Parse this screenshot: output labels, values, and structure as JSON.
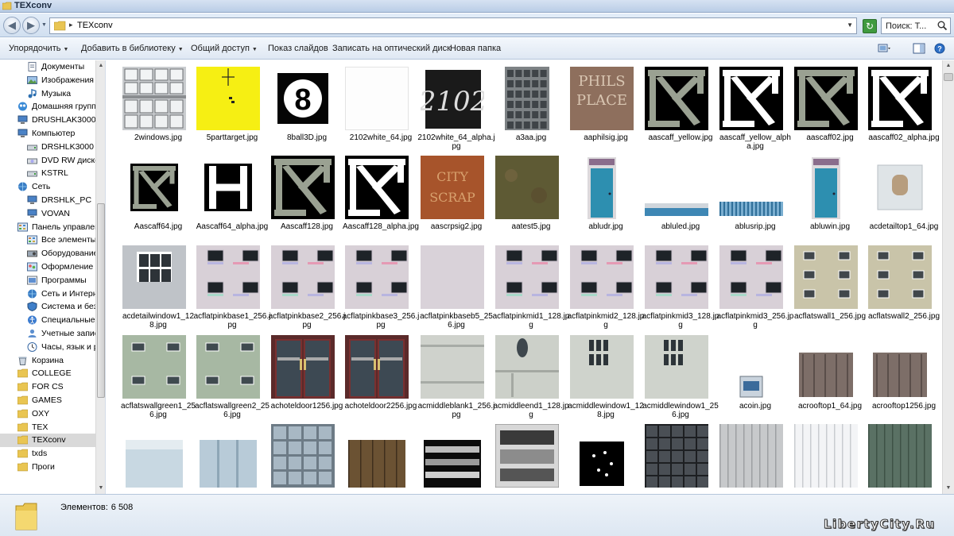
{
  "window": {
    "title": "TEXconv"
  },
  "address": {
    "path": "TEXconv",
    "search_placeholder": "Поиск: T..."
  },
  "toolbar": {
    "organize": "Упорядочить",
    "add_to_library": "Добавить в библиотеку",
    "share": "Общий доступ",
    "slideshow": "Показ слайдов",
    "burn": "Записать на оптический диск",
    "new_folder": "Новая папка"
  },
  "nav": {
    "items": [
      {
        "label": "Документы",
        "icon": "documents-icon"
      },
      {
        "label": "Изображения",
        "icon": "pictures-icon"
      },
      {
        "label": "Музыка",
        "icon": "music-icon"
      },
      {
        "label": "Домашняя группа",
        "icon": "homegroup-icon"
      },
      {
        "label": "DRUSHLAK3000",
        "icon": "computer-icon"
      },
      {
        "label": "Компьютер",
        "icon": "computer-icon"
      },
      {
        "label": "DRSHLK3000",
        "icon": "drive-icon"
      },
      {
        "label": "DVD RW дисковод",
        "icon": "dvd-icon"
      },
      {
        "label": "KSTRL",
        "icon": "drive-icon"
      },
      {
        "label": "Сеть",
        "icon": "network-icon"
      },
      {
        "label": "DRSHLK_PC",
        "icon": "computer-icon"
      },
      {
        "label": "VOVAN",
        "icon": "computer-icon"
      },
      {
        "label": "Панель управления",
        "icon": "control-panel-icon"
      },
      {
        "label": "Все элементы панели",
        "icon": "control-panel-icon"
      },
      {
        "label": "Оборудование и звук",
        "icon": "hardware-icon"
      },
      {
        "label": "Оформление и персонализация",
        "icon": "appearance-icon"
      },
      {
        "label": "Программы",
        "icon": "programs-icon"
      },
      {
        "label": "Сеть и Интернет",
        "icon": "network-icon"
      },
      {
        "label": "Система и безопасность",
        "icon": "security-icon"
      },
      {
        "label": "Специальные возможности",
        "icon": "accessibility-icon"
      },
      {
        "label": "Учетные записи",
        "icon": "users-icon"
      },
      {
        "label": "Часы, язык и регион",
        "icon": "clock-icon"
      },
      {
        "label": "Корзина",
        "icon": "recycle-bin-icon"
      },
      {
        "label": "COLLEGE",
        "icon": "folder-icon"
      },
      {
        "label": "FOR CS",
        "icon": "folder-icon"
      },
      {
        "label": "GAMES",
        "icon": "folder-icon"
      },
      {
        "label": "OXY",
        "icon": "folder-icon"
      },
      {
        "label": "TEX",
        "icon": "folder-icon"
      },
      {
        "label": "TEXconv",
        "icon": "folder-icon",
        "selected": true
      },
      {
        "label": "txds",
        "icon": "folder-icon"
      },
      {
        "label": "Проги",
        "icon": "folder-icon"
      }
    ]
  },
  "files": [
    {
      "name": "2windows.jpg",
      "kind": "windows-grid"
    },
    {
      "name": "5parttarget.jpg",
      "kind": "yellow-target"
    },
    {
      "name": "8ball3D.jpg",
      "kind": "eight-ball"
    },
    {
      "name": "2102white_64.jpg",
      "kind": "white"
    },
    {
      "name": "2102white_64_alpha.jpg",
      "kind": "text-2102"
    },
    {
      "name": "a3aa.jpg",
      "kind": "grey-building"
    },
    {
      "name": "aaphilsig.jpg",
      "kind": "phils-sign"
    },
    {
      "name": "aascaff_yellow.jpg",
      "kind": "scaffold"
    },
    {
      "name": "aascaff_yellow_alpha.jpg",
      "kind": "scaffold-alpha"
    },
    {
      "name": "aascaff02.jpg",
      "kind": "scaffold"
    },
    {
      "name": "aascaff02_alpha.jpg",
      "kind": "scaffold-alpha"
    },
    {
      "name": "Aascaff64.jpg",
      "kind": "scaffold-small"
    },
    {
      "name": "Aascaff64_alpha.jpg",
      "kind": "scaffold-alpha-small"
    },
    {
      "name": "Aascaff128.jpg",
      "kind": "scaffold"
    },
    {
      "name": "Aascaff128_alpha.jpg",
      "kind": "scaffold-alpha"
    },
    {
      "name": "aascrpsig2.jpg",
      "kind": "city-scrap"
    },
    {
      "name": "aatest5.jpg",
      "kind": "dirt"
    },
    {
      "name": "abludr.jpg",
      "kind": "blue-door"
    },
    {
      "name": "abluled.jpg",
      "kind": "blue-ledge"
    },
    {
      "name": "ablusrip.jpg",
      "kind": "blue-strip"
    },
    {
      "name": "abluwin.jpg",
      "kind": "blue-door"
    },
    {
      "name": "acdetailtop1_64.jpg",
      "kind": "detail-top"
    },
    {
      "name": "acdetailwindow1_128.jpg",
      "kind": "detail-window"
    },
    {
      "name": "acflatpinkbase1_256.jpg",
      "kind": "pink-flat"
    },
    {
      "name": "acflatpinkbase2_256.jpg",
      "kind": "pink-flat"
    },
    {
      "name": "acflatpinkbase3_256.jpg",
      "kind": "pink-flat"
    },
    {
      "name": "acflatpinkbaseb5_256.jpg",
      "kind": "pink-plain"
    },
    {
      "name": "acflatpinkmid1_128.jpg",
      "kind": "pink-flat"
    },
    {
      "name": "acflatpinkmid2_128.jpg",
      "kind": "pink-flat"
    },
    {
      "name": "acflatpinkmid3_128.jpg",
      "kind": "pink-flat"
    },
    {
      "name": "acflatpinkmid3_256.jpg",
      "kind": "pink-flat"
    },
    {
      "name": "acflatswall1_256.jpg",
      "kind": "khaki-wall"
    },
    {
      "name": "acflatswall2_256.jpg",
      "kind": "khaki-wall"
    },
    {
      "name": "acflatswallgreen1_256.jpg",
      "kind": "green-wall"
    },
    {
      "name": "acflatswallgreen2_256.jpg",
      "kind": "green-wall"
    },
    {
      "name": "achoteldoor1256.jpg",
      "kind": "hotel-door"
    },
    {
      "name": "achoteldoor2256.jpg",
      "kind": "hotel-door"
    },
    {
      "name": "acmiddleblank1_256.jpg",
      "kind": "middle-blank"
    },
    {
      "name": "acmiddleend1_128.jpg",
      "kind": "middle-end"
    },
    {
      "name": "acmiddlewindow1_128.jpg",
      "kind": "middle-window"
    },
    {
      "name": "acmiddlewindow1_256.jpg",
      "kind": "middle-window"
    },
    {
      "name": "acoin.jpg",
      "kind": "coin"
    },
    {
      "name": "acrooftop1_64.jpg",
      "kind": "rooftop"
    },
    {
      "name": "acrooftop1256.jpg",
      "kind": "rooftop"
    },
    {
      "name": "",
      "kind": "light-blue-wall"
    },
    {
      "name": "",
      "kind": "light-blue-wall2"
    },
    {
      "name": "",
      "kind": "glass-grid"
    },
    {
      "name": "",
      "kind": "wood"
    },
    {
      "name": "",
      "kind": "pipes"
    },
    {
      "name": "",
      "kind": "metal-parts"
    },
    {
      "name": "",
      "kind": "dots-black"
    },
    {
      "name": "",
      "kind": "boxes"
    },
    {
      "name": "",
      "kind": "grey-panel"
    },
    {
      "name": "",
      "kind": "white-panel"
    },
    {
      "name": "",
      "kind": "green-panel"
    }
  ],
  "status": {
    "label": "Элементов:",
    "count": "6 508"
  },
  "watermark": "LibertyCity.Ru"
}
